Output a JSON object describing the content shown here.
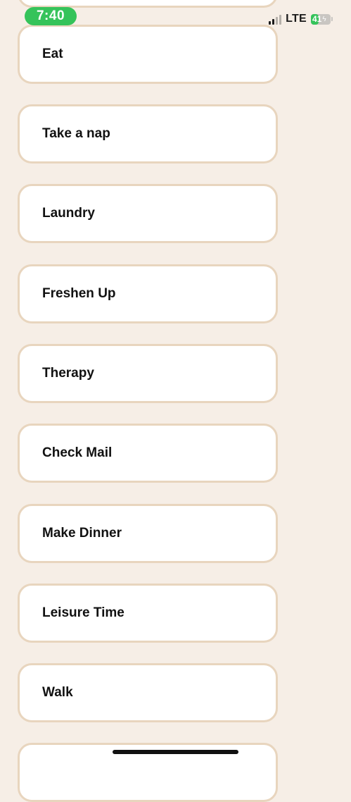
{
  "status_bar": {
    "time": "7:40",
    "network": "LTE",
    "battery_percent": "41",
    "battery_level": 0.41,
    "signal_bars_active": 2,
    "signal_bars_total": 4,
    "icons": [
      "signal-icon",
      "battery-icon",
      "charging-bolt-icon"
    ]
  },
  "tasks": [
    {
      "label": ""
    },
    {
      "label": "Eat"
    },
    {
      "label": "Take a nap"
    },
    {
      "label": "Laundry"
    },
    {
      "label": "Freshen Up"
    },
    {
      "label": "Therapy"
    },
    {
      "label": "Check Mail"
    },
    {
      "label": "Make Dinner"
    },
    {
      "label": "Leisure Time"
    },
    {
      "label": "Walk"
    },
    {
      "label": ""
    }
  ],
  "colors": {
    "background": "#f6eee6",
    "card_background": "#ffffff",
    "card_border": "#e8d5be",
    "time_pill": "#35c35a",
    "battery_fill": "#35c35a",
    "text": "#111111"
  }
}
